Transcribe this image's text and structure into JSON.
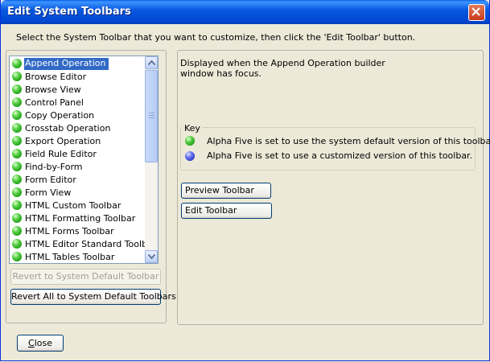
{
  "window": {
    "title": "Edit System Toolbars"
  },
  "instructions": "Select the System Toolbar that you want to customize, then click the 'Edit Toolbar' button.",
  "toolbar_list": {
    "selected_index": 0,
    "items": [
      {
        "label": "Append Operation",
        "status": "system-default"
      },
      {
        "label": "Browse Editor",
        "status": "system-default"
      },
      {
        "label": "Browse View",
        "status": "system-default"
      },
      {
        "label": "Control Panel",
        "status": "system-default"
      },
      {
        "label": "Copy Operation",
        "status": "system-default"
      },
      {
        "label": "Crosstab Operation",
        "status": "system-default"
      },
      {
        "label": "Export Operation",
        "status": "system-default"
      },
      {
        "label": "Field Rule Editor",
        "status": "system-default"
      },
      {
        "label": "Find-by-Form",
        "status": "system-default"
      },
      {
        "label": "Form Editor",
        "status": "system-default"
      },
      {
        "label": "Form View",
        "status": "system-default"
      },
      {
        "label": "HTML Custom Toolbar",
        "status": "system-default"
      },
      {
        "label": "HTML Formatting Toolbar",
        "status": "system-default"
      },
      {
        "label": "HTML Forms Toolbar",
        "status": "system-default"
      },
      {
        "label": "HTML Editor Standard Toolbar",
        "status": "system-default"
      },
      {
        "label": "HTML Tables Toolbar",
        "status": "system-default"
      }
    ]
  },
  "buttons": {
    "revert": "Revert to System Default Toolbar",
    "revert_all": "Revert All to System Default Toolbars",
    "preview": "Preview Toolbar",
    "edit": "Edit Toolbar",
    "close_prefix": "",
    "close_mnemonic": "C",
    "close_rest": "lose"
  },
  "description": "Displayed when the Append Operation builder window has focus.",
  "key": {
    "label": "Key",
    "default_text": "Alpha Five is set to use the system default version of this toolbar.",
    "custom_text": "Alpha Five is set to use a customized version of this toolbar."
  },
  "icons": {
    "default_status": "green-dot-icon",
    "custom_status": "blue-dot-icon"
  },
  "colors": {
    "titlebar": "#0a59e0",
    "selection": "#316ac5",
    "default_dot": "#2fb52a",
    "custom_dot": "#3a46d8"
  }
}
